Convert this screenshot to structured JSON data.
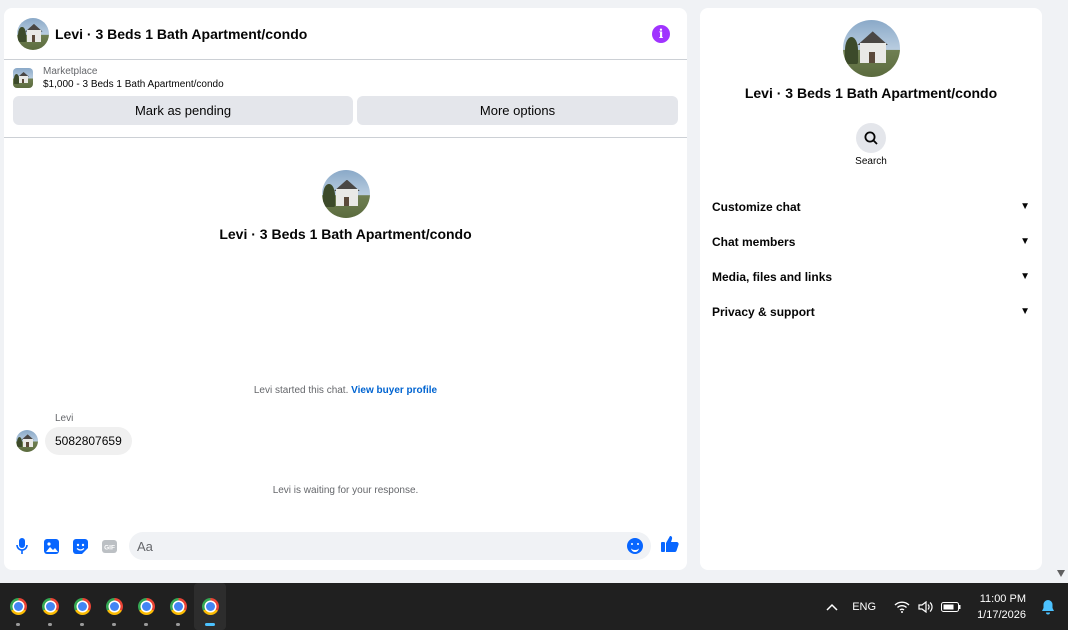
{
  "chat": {
    "header_title": "Levi · 3 Beds 1 Bath Apartment/condo",
    "listing": {
      "source": "Marketplace",
      "price_title": "$1,000 - 3 Beds 1 Bath Apartment/condo"
    },
    "buttons": {
      "mark_pending": "Mark as pending",
      "more_options": "More options"
    },
    "profile_name": "Levi · 3 Beds 1 Bath Apartment/condo",
    "started_text": "Levi started this chat.",
    "buyer_profile_link": "View buyer profile",
    "sender": "Levi",
    "message": "5082807659",
    "waiting_text": "Levi is waiting for your response.",
    "composer_placeholder": "Aa",
    "gif_label": "GIF"
  },
  "info_panel": {
    "name": "Levi · 3 Beds 1 Bath Apartment/condo",
    "search_label": "Search",
    "menu": [
      {
        "label": "Customize chat"
      },
      {
        "label": "Chat members"
      },
      {
        "label": "Media, files and links"
      },
      {
        "label": "Privacy & support"
      }
    ]
  },
  "taskbar": {
    "language": "ENG",
    "time": "11:00 PM",
    "date": "1/17/2026",
    "apps_count_label": ""
  },
  "colors": {
    "accent": "#0866ff",
    "info_icon": "#a033ff",
    "link": "#0064d1"
  }
}
